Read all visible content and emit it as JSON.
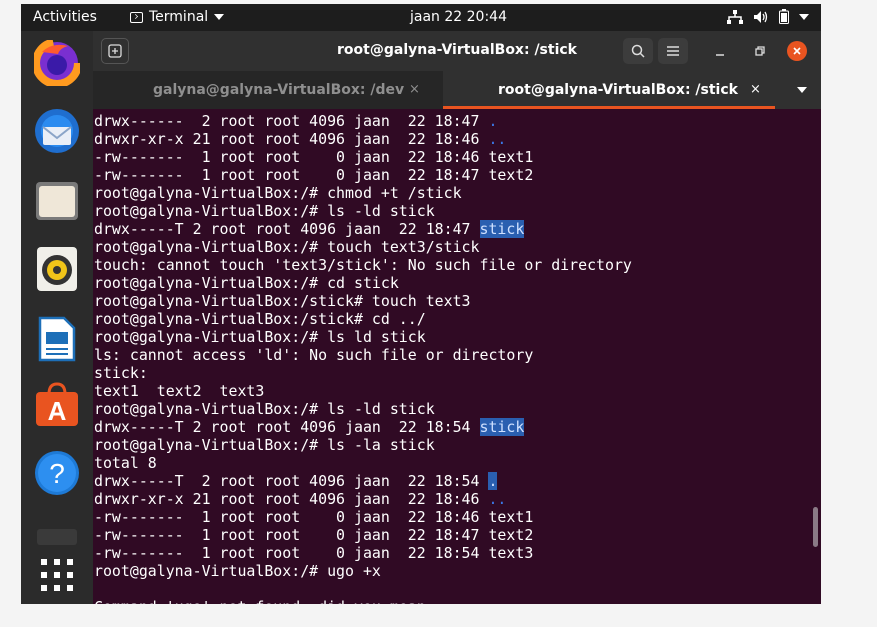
{
  "topbar": {
    "activities": "Activities",
    "app_name": "Terminal",
    "clock": "jaan 22  20:44"
  },
  "dock": {
    "items": [
      "Firefox",
      "Thunderbird",
      "Files",
      "Rhythmbox",
      "LibreOffice Writer",
      "Ubuntu Software",
      "Help",
      "Terminal",
      "Show Applications"
    ]
  },
  "window": {
    "title": "root@galyna-VirtualBox: /stick"
  },
  "tabs": [
    {
      "label": "galyna@galyna-VirtualBox: /dev",
      "close": "×"
    },
    {
      "label": "root@galyna-VirtualBox: /stick",
      "close": "×"
    }
  ],
  "terminal": {
    "lines": [
      "drwx------  2 root root 4096 jaan  22 18:47 ",
      "drwxr-xr-x 21 root root 4096 jaan  22 18:46 ",
      "-rw-------  1 root root    0 jaan  22 18:46 text1",
      "-rw-------  1 root root    0 jaan  22 18:47 text2",
      "root@galyna-VirtualBox:/# chmod +t /stick",
      "root@galyna-VirtualBox:/# ls -ld stick",
      "drwx-----T 2 root root 4096 jaan  22 18:47 ",
      "root@galyna-VirtualBox:/# touch text3/stick",
      "touch: cannot touch 'text3/stick': No such file or directory",
      "root@galyna-VirtualBox:/# cd stick",
      "root@galyna-VirtualBox:/stick# touch text3",
      "root@galyna-VirtualBox:/stick# cd ../",
      "root@galyna-VirtualBox:/# ls ld stick",
      "ls: cannot access 'ld': No such file or directory",
      "stick:",
      "text1  text2  text3",
      "root@galyna-VirtualBox:/# ls -ld stick",
      "drwx-----T 2 root root 4096 jaan  22 18:54 ",
      "root@galyna-VirtualBox:/# ls -la stick",
      "total 8",
      "drwx-----T  2 root root 4096 jaan  22 18:54 ",
      "drwxr-xr-x 21 root root 4096 jaan  22 18:46 ",
      "-rw-------  1 root root    0 jaan  22 18:46 text1",
      "-rw-------  1 root root    0 jaan  22 18:47 text2",
      "-rw-------  1 root root    0 jaan  22 18:54 text3",
      "root@galyna-VirtualBox:/# ugo +x",
      "",
      "Command 'ugo' not found, did you mean:"
    ],
    "tail_segments": {
      "0": ".",
      "1": "..",
      "6": "stick",
      "17": "stick",
      "20": ".",
      "21": ".."
    }
  },
  "colors": {
    "terminal_bg": "#300a24",
    "accent": "#e95420",
    "dir_blue": "#3b78e7",
    "selection": "#2a5fb0"
  }
}
